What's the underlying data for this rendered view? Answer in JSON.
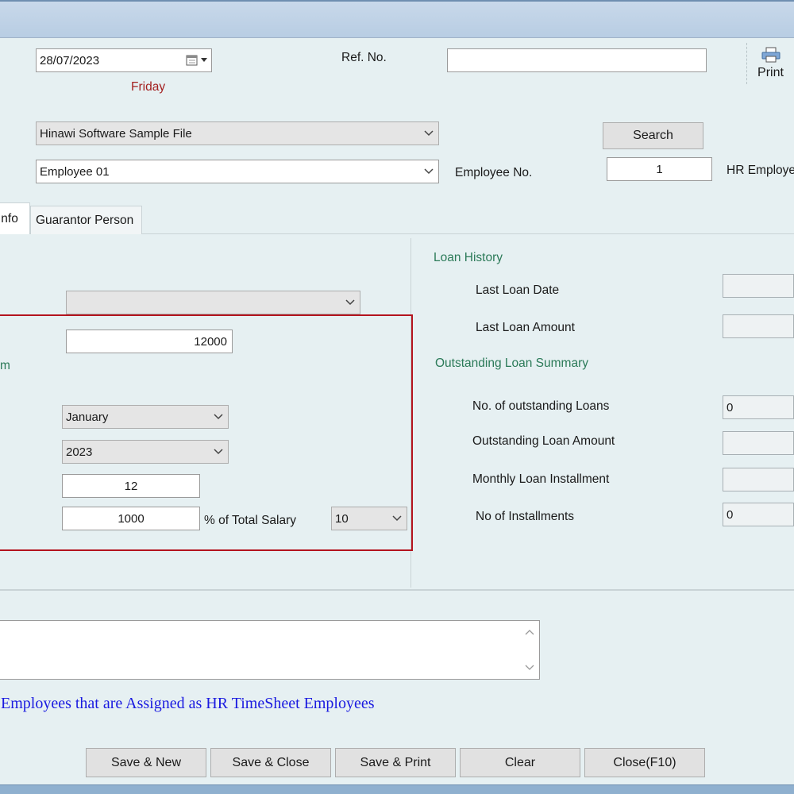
{
  "header": {
    "date_value": "28/07/2023",
    "day_label": "Friday",
    "ref_no_label": "Ref. No.",
    "ref_no_value": "",
    "print_label": "Print"
  },
  "selection": {
    "company_value": "Hinawi Software Sample File",
    "employee_value": "Employee 01",
    "search_label": "Search",
    "employee_no_label": "Employee No.",
    "employee_no_value": "1",
    "hr_employee_label": "HR Employe"
  },
  "tabs": [
    {
      "label": "Info"
    },
    {
      "label": "Guarantor Person"
    }
  ],
  "loan_form": {
    "type_combo_value": "",
    "amount_value": "12000",
    "partial_label": "m",
    "month_value": "January",
    "year_value": "2023",
    "installments_value": "12",
    "installment_amount_value": "1000",
    "percent_label": "% of Total Salary",
    "percent_value": "10"
  },
  "loan_history": {
    "section_label": "Loan History",
    "last_loan_date_label": "Last Loan Date",
    "last_loan_date_value": "",
    "last_loan_amount_label": "Last Loan Amount",
    "last_loan_amount_value": ""
  },
  "outstanding": {
    "section_label": "Outstanding Loan Summary",
    "count_label": "No. of outstanding Loans",
    "count_value": "0",
    "amount_label": "Outstanding Loan Amount",
    "amount_value": "",
    "monthly_label": "Monthly Loan Installment",
    "monthly_value": "",
    "installments_label": "No of Installments",
    "installments_value": "0"
  },
  "notes": {
    "memo_value": "",
    "info_text": "Employees that are Assigned as HR  TimeSheet Employees"
  },
  "footer": {
    "save_new": "Save & New",
    "save_close": "Save & Close",
    "save_print": "Save & Print",
    "clear": "Clear",
    "close": "Close(F10)"
  },
  "colors": {
    "background": "#e6f0f2",
    "accent_green": "#2b7a58",
    "day_red": "#a31f1f",
    "highlight_box": "#b4141e",
    "info_blue": "#1a1ae0"
  }
}
